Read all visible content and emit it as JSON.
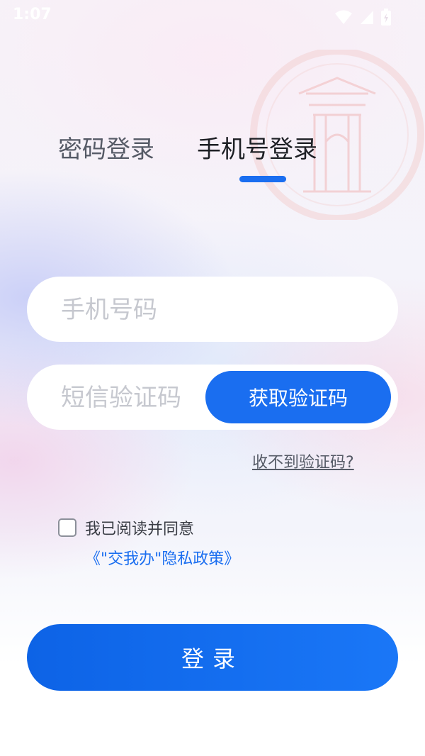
{
  "status_bar": {
    "time": "1:07"
  },
  "tabs": [
    {
      "label": "密码登录",
      "active": false
    },
    {
      "label": "手机号登录",
      "active": true
    }
  ],
  "phone_input": {
    "placeholder": "手机号码",
    "value": ""
  },
  "sms_input": {
    "placeholder": "短信验证码",
    "value": ""
  },
  "sms_button": {
    "label": "获取验证码"
  },
  "no_code_link": {
    "label": "收不到验证码?"
  },
  "agreement": {
    "checked": false,
    "prefix": "我已阅读并同意",
    "link": "《\"交我办\"隐私政策》"
  },
  "login_button": {
    "label": "登录"
  },
  "colors": {
    "accent": "#1a6ef0",
    "emblem": "#f2c9cc"
  },
  "icons": [
    "wifi-icon",
    "signal-icon",
    "battery-icon",
    "emblem-watermark"
  ]
}
